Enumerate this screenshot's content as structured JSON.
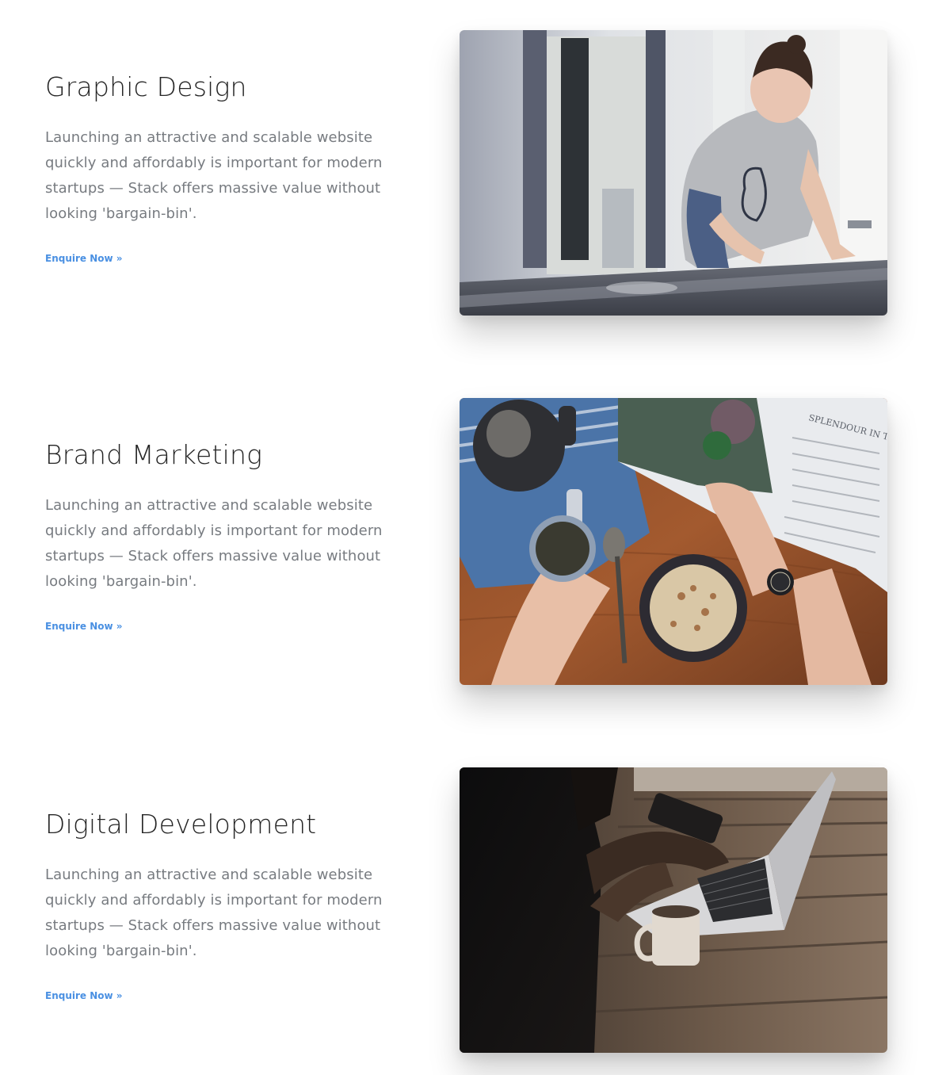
{
  "features": [
    {
      "title": "Graphic Design",
      "description": "Launching an attractive and scalable website quickly and affordably is important for modern startups — Stack offers massive value without looking 'bargain-bin'.",
      "link_label": "Enquire Now »",
      "image_subject": "woman-drawing-at-table-photo"
    },
    {
      "title": "Brand Marketing",
      "description": "Launching an attractive and scalable website quickly and affordably is important for modern startups — Stack offers massive value without looking 'bargain-bin'.",
      "link_label": "Enquire Now »",
      "image_subject": "coffee-and-magazine-photo",
      "magazine_heading": "SPLENDOUR IN THE GRASS"
    },
    {
      "title": "Digital Development",
      "description": "Launching an attractive and scalable website quickly and affordably is important for modern startups — Stack offers massive value without looking 'bargain-bin'.",
      "link_label": "Enquire Now »",
      "image_subject": "laptop-on-wooden-table-photo"
    }
  ],
  "colors": {
    "heading": "#252525",
    "body_text": "#777b80",
    "link": "#4a90e2",
    "background": "#ffffff"
  }
}
